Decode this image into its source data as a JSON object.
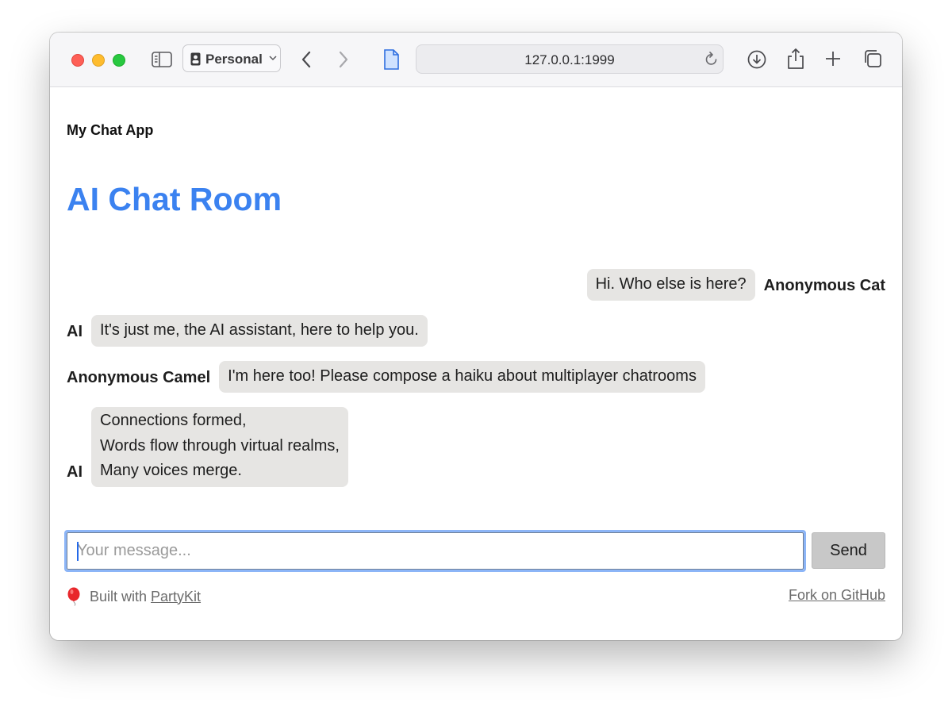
{
  "browser": {
    "profile_label": "Personal",
    "url": "127.0.0.1:1999"
  },
  "app": {
    "name": "My Chat App",
    "room_title": "AI Chat Room"
  },
  "messages": [
    {
      "sender": "Anonymous Cat",
      "align": "right",
      "lines": [
        "Hi. Who else is here?"
      ]
    },
    {
      "sender": "AI",
      "align": "left",
      "lines": [
        "It's just me, the AI assistant, here to help you."
      ]
    },
    {
      "sender": "Anonymous Camel",
      "align": "left",
      "lines": [
        "I'm here too! Please compose a haiku about multiplayer chatrooms"
      ]
    },
    {
      "sender": "AI",
      "align": "left",
      "lines": [
        "Connections formed,",
        "Words flow through virtual realms,",
        "Many voices merge."
      ]
    }
  ],
  "composer": {
    "placeholder": "Your message...",
    "value": "",
    "send_label": "Send"
  },
  "footer": {
    "built_with": "Built with",
    "partykit_link": "PartyKit",
    "fork_link": "Fork on GitHub"
  },
  "colors": {
    "accent": "#3b82f0",
    "bubble": "#e6e5e3",
    "focus_ring": "#8cb5f7"
  }
}
